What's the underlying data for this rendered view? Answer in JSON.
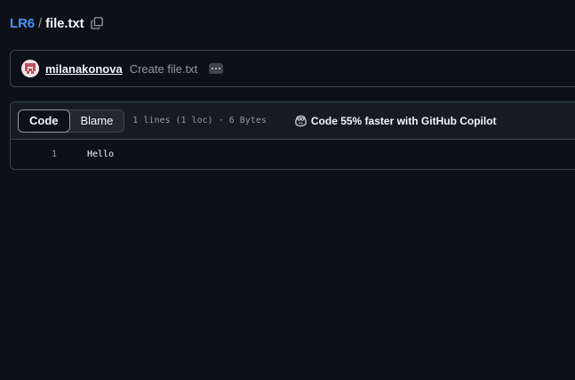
{
  "breadcrumb": {
    "repo": "LR6",
    "separator": "/",
    "file": "file.txt",
    "copy_icon": "copy-icon"
  },
  "commit": {
    "author": "milanakonova",
    "message": "Create file.txt",
    "avatar_icon": "identicon-avatar",
    "more_icon": "kebab-horizontal-icon"
  },
  "file": {
    "tabs": [
      {
        "label": "Code",
        "active": true
      },
      {
        "label": "Blame",
        "active": false
      }
    ],
    "info": "1 lines (1 loc) · 6 Bytes",
    "copilot_label": "Code 55% faster with GitHub Copilot",
    "copilot_icon": "copilot-icon",
    "lines": [
      {
        "number": "1",
        "text": "Hello"
      }
    ]
  },
  "colors": {
    "background": "#0d1117",
    "link": "#4493f8",
    "border": "#3d444d",
    "muted": "#9198a1"
  }
}
